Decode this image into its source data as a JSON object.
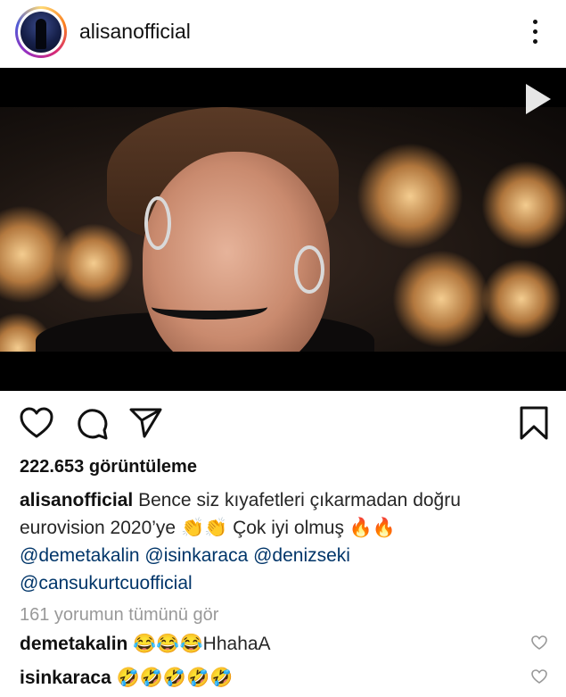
{
  "header": {
    "username": "alisanofficial",
    "more_icon": "more-vertical-icon"
  },
  "video": {
    "play_icon": "play-icon"
  },
  "actions": {
    "like_icon": "heart-icon",
    "comment_icon": "comment-icon",
    "share_icon": "send-icon",
    "save_icon": "bookmark-icon"
  },
  "views": "222.653 görüntüleme",
  "caption": {
    "username": "alisanofficial",
    "text": "Bence siz kıyafetleri çıkarmadan doğru eurovision 2020’ye 👏👏 Çok iyi olmuş 🔥🔥",
    "mentions": [
      "@demetakalin",
      "@isinkaraca",
      "@denizseki",
      "@cansukurtcuofficial"
    ]
  },
  "view_all_comments": "161 yorumun tümünü gör",
  "comments": [
    {
      "username": "demetakalin",
      "text": "😂😂😂HhahaA"
    },
    {
      "username": "isinkaraca",
      "text": "🤣🤣🤣🤣🤣"
    }
  ]
}
